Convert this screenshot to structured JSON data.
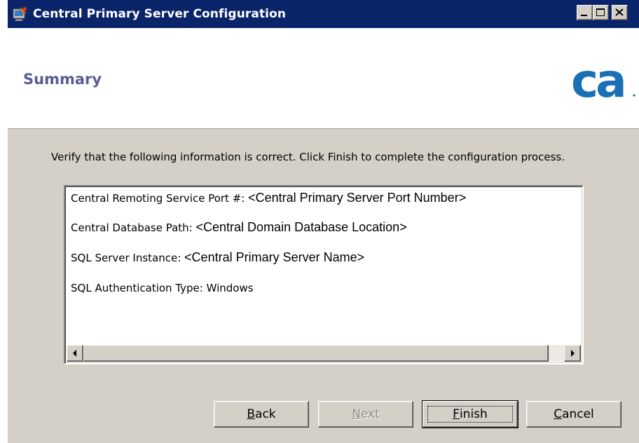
{
  "window": {
    "title": "Central Primary Server Configuration"
  },
  "header": {
    "title": "Summary",
    "logo_text": "ca",
    "logo_color": "#1a6fb5"
  },
  "instruction": "Verify that the following information is correct. Click Finish to complete the configuration process.",
  "summary": [
    {
      "label": "Central Remoting Service Port #:",
      "value": "<Central Primary Server Port Number>"
    },
    {
      "label": "Central Database Path:",
      "value": "<Central Domain Database Location>"
    },
    {
      "label": "SQL Server Instance:",
      "value": "<Central Primary Server Name>"
    },
    {
      "label": "SQL Authentication Type:",
      "value": "Windows"
    }
  ],
  "buttons": {
    "back": {
      "mnemonic": "B",
      "rest": "ack",
      "enabled": true
    },
    "next": {
      "mnemonic": "N",
      "rest": "ext",
      "enabled": false
    },
    "finish": {
      "mnemonic": "F",
      "rest": "inish",
      "enabled": true,
      "default": true
    },
    "cancel": {
      "mnemonic": "C",
      "rest": "ancel",
      "enabled": true
    }
  },
  "icons": {
    "title": "setup-wizard-icon",
    "minimize": "minimize-icon",
    "maximize": "maximize-icon",
    "close": "close-icon",
    "scroll_left": "arrow-left-icon",
    "scroll_right": "arrow-right-icon"
  },
  "colors": {
    "titlebar": "#0a246a",
    "dialog": "#d4d0c8",
    "header_title": "#5b5b94"
  }
}
